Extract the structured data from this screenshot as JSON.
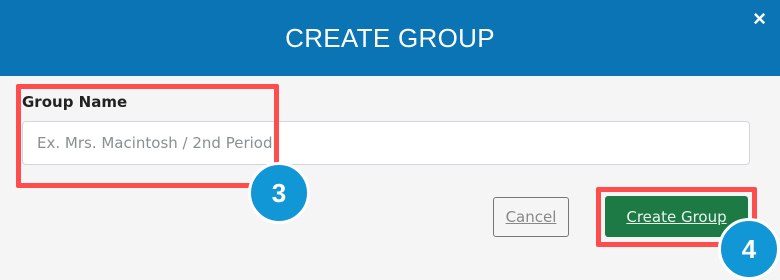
{
  "dialog": {
    "title": "CREATE GROUP",
    "close_symbol": "×",
    "close_icon": "close-icon"
  },
  "form": {
    "group_name_label": "Group Name",
    "group_name_placeholder": "Ex. Mrs. Macintosh / 2nd Period",
    "group_name_value": ""
  },
  "actions": {
    "cancel_label": "Cancel",
    "create_label": "Create Group"
  },
  "annotations": {
    "step_3": "3",
    "step_4": "4"
  },
  "colors": {
    "header": "#0b74b5",
    "create_button": "#1e7a45",
    "highlight": "#ff4c4c",
    "badge": "#1196d6"
  }
}
